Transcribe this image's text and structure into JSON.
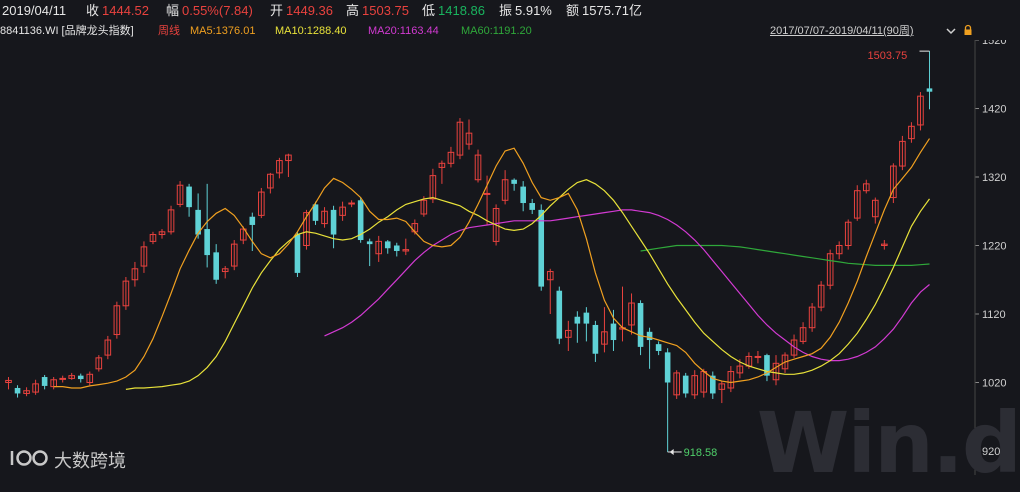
{
  "header": {
    "date": "2019/04/11",
    "close_label": "收",
    "close_value": "1444.52",
    "change_label": "幅",
    "change_value": "0.55%(7.84)",
    "open_label": "开",
    "open_value": "1449.36",
    "high_label": "高",
    "high_value": "1503.75",
    "low_label": "低",
    "low_value": "1418.86",
    "amplitude_label": "振",
    "amplitude_value": "5.91%",
    "amount_label": "额",
    "amount_value": "1575.71亿"
  },
  "legend": {
    "code": "8841136.WI [品牌龙头指数]",
    "period": "周线",
    "ma5": "MA5:1376.01",
    "ma10": "MA10:1288.40",
    "ma20": "MA20:1163.44",
    "ma60": "MA60:1191.20",
    "range": "2017/07/07-2019/04/11(90周)"
  },
  "colors": {
    "up": "#e8423e",
    "down": "#5fd2d6",
    "ma5": "#f0a020",
    "ma10": "#e8e23a",
    "ma20": "#d23ad2",
    "ma60": "#2fa83a",
    "background": "#16171c"
  },
  "icons": {
    "dropdown": "chevron-down-icon",
    "lock": "lock-icon"
  },
  "logo_text": "大数跨境",
  "watermark": "Win.d",
  "chart_data": {
    "type": "candlestick",
    "period": "weekly",
    "y_ticks": [
      920,
      1020,
      1120,
      1220,
      1320,
      1420,
      1520
    ],
    "ylim": [
      900,
      1540
    ],
    "annotations": [
      {
        "label": "1503.75",
        "value": 1503.75,
        "kind": "high"
      },
      {
        "label": "918.58",
        "value": 918.58,
        "kind": "low"
      }
    ],
    "candles": [
      [
        1020,
        1023,
        1010,
        1028
      ],
      [
        1012,
        1004,
        998,
        1016
      ],
      [
        1004,
        1008,
        1000,
        1013
      ],
      [
        1006,
        1018,
        1002,
        1024
      ],
      [
        1028,
        1015,
        1010,
        1031
      ],
      [
        1014,
        1024,
        1010,
        1028
      ],
      [
        1026,
        1026,
        1020,
        1030
      ],
      [
        1026,
        1030,
        1024,
        1034
      ],
      [
        1030,
        1025,
        1020,
        1033
      ],
      [
        1020,
        1032,
        1016,
        1036
      ],
      [
        1040,
        1056,
        1036,
        1060
      ],
      [
        1060,
        1082,
        1054,
        1088
      ],
      [
        1090,
        1132,
        1084,
        1138
      ],
      [
        1132,
        1168,
        1126,
        1174
      ],
      [
        1170,
        1186,
        1160,
        1196
      ],
      [
        1190,
        1218,
        1180,
        1226
      ],
      [
        1226,
        1236,
        1222,
        1240
      ],
      [
        1236,
        1240,
        1230,
        1244
      ],
      [
        1240,
        1272,
        1236,
        1278
      ],
      [
        1280,
        1308,
        1276,
        1314
      ],
      [
        1306,
        1276,
        1262,
        1310
      ],
      [
        1272,
        1236,
        1230,
        1296
      ],
      [
        1244,
        1206,
        1188,
        1310
      ],
      [
        1210,
        1170,
        1164,
        1222
      ],
      [
        1182,
        1186,
        1172,
        1190
      ],
      [
        1190,
        1222,
        1184,
        1228
      ],
      [
        1228,
        1244,
        1222,
        1248
      ],
      [
        1262,
        1250,
        1212,
        1268
      ],
      [
        1264,
        1298,
        1260,
        1304
      ],
      [
        1304,
        1324,
        1296,
        1326
      ],
      [
        1326,
        1344,
        1318,
        1348
      ],
      [
        1344,
        1352,
        1320,
        1354
      ],
      [
        1236,
        1180,
        1174,
        1240
      ],
      [
        1220,
        1268,
        1214,
        1272
      ],
      [
        1280,
        1256,
        1250,
        1284
      ],
      [
        1252,
        1270,
        1246,
        1276
      ],
      [
        1272,
        1236,
        1216,
        1278
      ],
      [
        1264,
        1276,
        1256,
        1284
      ],
      [
        1282,
        1282,
        1276,
        1286
      ],
      [
        1286,
        1228,
        1224,
        1290
      ],
      [
        1226,
        1222,
        1190,
        1230
      ],
      [
        1208,
        1226,
        1196,
        1234
      ],
      [
        1226,
        1216,
        1208,
        1228
      ],
      [
        1220,
        1212,
        1204,
        1224
      ],
      [
        1212,
        1214,
        1206,
        1230
      ],
      [
        1240,
        1252,
        1236,
        1258
      ],
      [
        1266,
        1286,
        1262,
        1292
      ],
      [
        1288,
        1322,
        1282,
        1332
      ],
      [
        1334,
        1340,
        1310,
        1344
      ],
      [
        1340,
        1356,
        1334,
        1364
      ],
      [
        1352,
        1400,
        1346,
        1406
      ],
      [
        1368,
        1384,
        1360,
        1404
      ],
      [
        1316,
        1352,
        1312,
        1360
      ],
      [
        1296,
        1296,
        1250,
        1322
      ],
      [
        1226,
        1274,
        1220,
        1280
      ],
      [
        1286,
        1316,
        1280,
        1330
      ],
      [
        1316,
        1310,
        1300,
        1318
      ],
      [
        1306,
        1282,
        1270,
        1314
      ],
      [
        1282,
        1272,
        1266,
        1288
      ],
      [
        1272,
        1160,
        1154,
        1280
      ],
      [
        1170,
        1182,
        1120,
        1186
      ],
      [
        1154,
        1084,
        1076,
        1160
      ],
      [
        1086,
        1096,
        1066,
        1110
      ],
      [
        1116,
        1106,
        1078,
        1124
      ],
      [
        1122,
        1106,
        1080,
        1130
      ],
      [
        1104,
        1062,
        1050,
        1110
      ],
      [
        1076,
        1094,
        1064,
        1130
      ],
      [
        1106,
        1082,
        1066,
        1126
      ],
      [
        1098,
        1100,
        1080,
        1160
      ],
      [
        1104,
        1136,
        1090,
        1150
      ],
      [
        1136,
        1072,
        1060,
        1140
      ],
      [
        1094,
        1082,
        1040,
        1100
      ],
      [
        1076,
        1066,
        1060,
        1080
      ],
      [
        1064,
        1020,
        918.58,
        1070
      ],
      [
        1002,
        1034,
        996,
        1038
      ],
      [
        1030,
        1004,
        998,
        1034
      ],
      [
        1002,
        1030,
        996,
        1038
      ],
      [
        1006,
        1036,
        998,
        1040
      ],
      [
        1030,
        1004,
        996,
        1036
      ],
      [
        1010,
        1018,
        990,
        1022
      ],
      [
        1012,
        1036,
        1006,
        1044
      ],
      [
        1034,
        1044,
        1026,
        1054
      ],
      [
        1044,
        1058,
        1040,
        1064
      ],
      [
        1058,
        1058,
        1048,
        1066
      ],
      [
        1060,
        1030,
        1022,
        1062
      ],
      [
        1024,
        1048,
        1016,
        1060
      ],
      [
        1040,
        1060,
        1034,
        1064
      ],
      [
        1060,
        1082,
        1056,
        1090
      ],
      [
        1080,
        1100,
        1076,
        1108
      ],
      [
        1100,
        1130,
        1094,
        1136
      ],
      [
        1130,
        1162,
        1124,
        1168
      ],
      [
        1162,
        1208,
        1156,
        1214
      ],
      [
        1208,
        1220,
        1200,
        1226
      ],
      [
        1220,
        1254,
        1214,
        1258
      ],
      [
        1260,
        1300,
        1256,
        1308
      ],
      [
        1300,
        1310,
        1296,
        1316
      ],
      [
        1262,
        1286,
        1252,
        1290
      ],
      [
        1220,
        1222,
        1214,
        1228
      ],
      [
        1290,
        1336,
        1282,
        1340
      ],
      [
        1336,
        1372,
        1330,
        1380
      ],
      [
        1376,
        1394,
        1370,
        1400
      ],
      [
        1396,
        1438,
        1388,
        1444
      ],
      [
        1449.36,
        1444.52,
        1418.86,
        1503.75
      ]
    ],
    "ma5": [
      1014,
      1014,
      1012,
      1012,
      1015,
      1017,
      1019,
      1022,
      1028,
      1038,
      1058,
      1084,
      1116,
      1150,
      1186,
      1213,
      1238,
      1255,
      1267,
      1274,
      1264,
      1246,
      1226,
      1208,
      1202,
      1208,
      1222,
      1240,
      1262,
      1282,
      1304,
      1318,
      1312,
      1302,
      1290,
      1270,
      1258,
      1258,
      1260,
      1255,
      1240,
      1226,
      1220,
      1218,
      1220,
      1232,
      1254,
      1280,
      1308,
      1336,
      1358,
      1362,
      1340,
      1312,
      1290,
      1286,
      1290,
      1296,
      1272,
      1230,
      1180,
      1140,
      1114,
      1100,
      1094,
      1088,
      1086,
      1082,
      1078,
      1074,
      1064,
      1048,
      1036,
      1026,
      1022,
      1020,
      1022,
      1024,
      1028,
      1034,
      1042,
      1050,
      1054,
      1058,
      1062,
      1070,
      1086,
      1108,
      1136,
      1168,
      1204,
      1238,
      1272,
      1302,
      1318,
      1334,
      1356,
      1376
    ],
    "ma10": [
      1010,
      1012,
      1012,
      1013,
      1014,
      1016,
      1018,
      1022,
      1030,
      1042,
      1058,
      1080,
      1106,
      1132,
      1158,
      1180,
      1198,
      1214,
      1226,
      1236,
      1240,
      1238,
      1234,
      1230,
      1228,
      1230,
      1236,
      1244,
      1254,
      1262,
      1272,
      1280,
      1284,
      1288,
      1290,
      1286,
      1282,
      1278,
      1270,
      1264,
      1256,
      1250,
      1244,
      1242,
      1244,
      1252,
      1264,
      1278,
      1290,
      1302,
      1312,
      1316,
      1310,
      1300,
      1286,
      1268,
      1248,
      1228,
      1208,
      1186,
      1164,
      1144,
      1126,
      1108,
      1092,
      1080,
      1068,
      1058,
      1050,
      1044,
      1040,
      1036,
      1034,
      1032,
      1032,
      1034,
      1038,
      1044,
      1052,
      1062,
      1076,
      1092,
      1112,
      1134,
      1160,
      1188,
      1218,
      1248,
      1270,
      1288
    ],
    "ma20": [
      1088,
      1094,
      1100,
      1108,
      1118,
      1130,
      1142,
      1156,
      1170,
      1184,
      1198,
      1210,
      1220,
      1228,
      1236,
      1242,
      1246,
      1248,
      1250,
      1252,
      1254,
      1256,
      1256,
      1256,
      1256,
      1256,
      1258,
      1260,
      1262,
      1264,
      1266,
      1268,
      1270,
      1272,
      1272,
      1270,
      1268,
      1264,
      1258,
      1250,
      1240,
      1228,
      1214,
      1198,
      1182,
      1166,
      1150,
      1134,
      1118,
      1104,
      1092,
      1082,
      1072,
      1064,
      1058,
      1054,
      1052,
      1052,
      1054,
      1058,
      1064,
      1072,
      1084,
      1098,
      1116,
      1136,
      1152,
      1163
    ],
    "ma60": [
      1212,
      1214,
      1216,
      1218,
      1220,
      1220,
      1220,
      1220,
      1220,
      1220,
      1219,
      1218,
      1216,
      1214,
      1212,
      1210,
      1208,
      1206,
      1204,
      1202,
      1200,
      1198,
      1196,
      1194,
      1193,
      1192,
      1191,
      1191,
      1191,
      1191,
      1191,
      1192,
      1193
    ]
  }
}
